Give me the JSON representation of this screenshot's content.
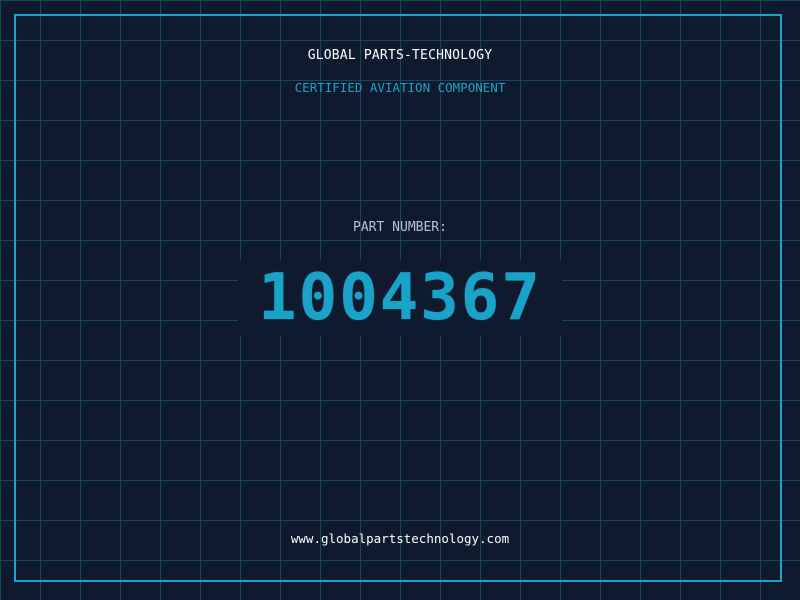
{
  "header": {
    "company": "GLOBAL PARTS-TECHNOLOGY",
    "certification": "CERTIFIED AVIATION COMPONENT"
  },
  "part": {
    "label": "PART NUMBER:",
    "number": "1004367"
  },
  "footer": {
    "url": "www.globalpartstechnology.com"
  },
  "colors": {
    "background": "#101a2e",
    "grid": "#174a5f",
    "accent": "#1aa3c8",
    "text": "#ffffff",
    "muted": "#b7c4d6"
  }
}
